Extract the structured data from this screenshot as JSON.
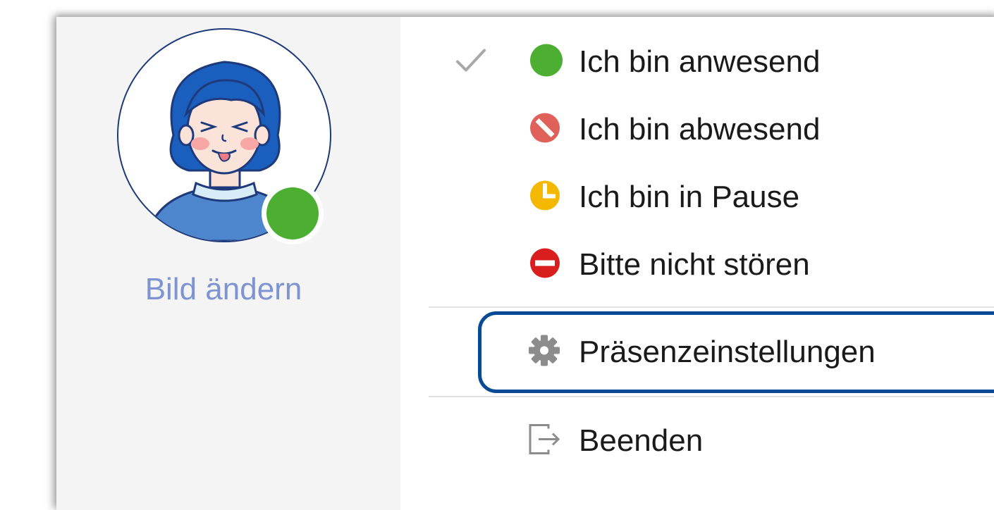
{
  "profile": {
    "change_picture_label": "Bild ändern",
    "status_color": "#4caf32"
  },
  "status_menu": {
    "items": [
      {
        "label": "Ich bin anwesend",
        "icon": "green-dot-icon",
        "color": "#4caf32",
        "selected": true
      },
      {
        "label": "Ich bin abwesend",
        "icon": "away-blocked-icon",
        "color": "#e0605a",
        "selected": false
      },
      {
        "label": "Ich bin in Pause",
        "icon": "clock-icon",
        "color": "#f5b800",
        "selected": false
      },
      {
        "label": "Bitte nicht stören",
        "icon": "do-not-disturb-icon",
        "color": "#d81e1e",
        "selected": false
      }
    ],
    "settings_label": "Präsenzeinstellungen",
    "settings_icon": "gear-icon",
    "exit_label": "Beenden",
    "exit_icon": "exit-icon",
    "highlight_color": "#0a4a94"
  }
}
